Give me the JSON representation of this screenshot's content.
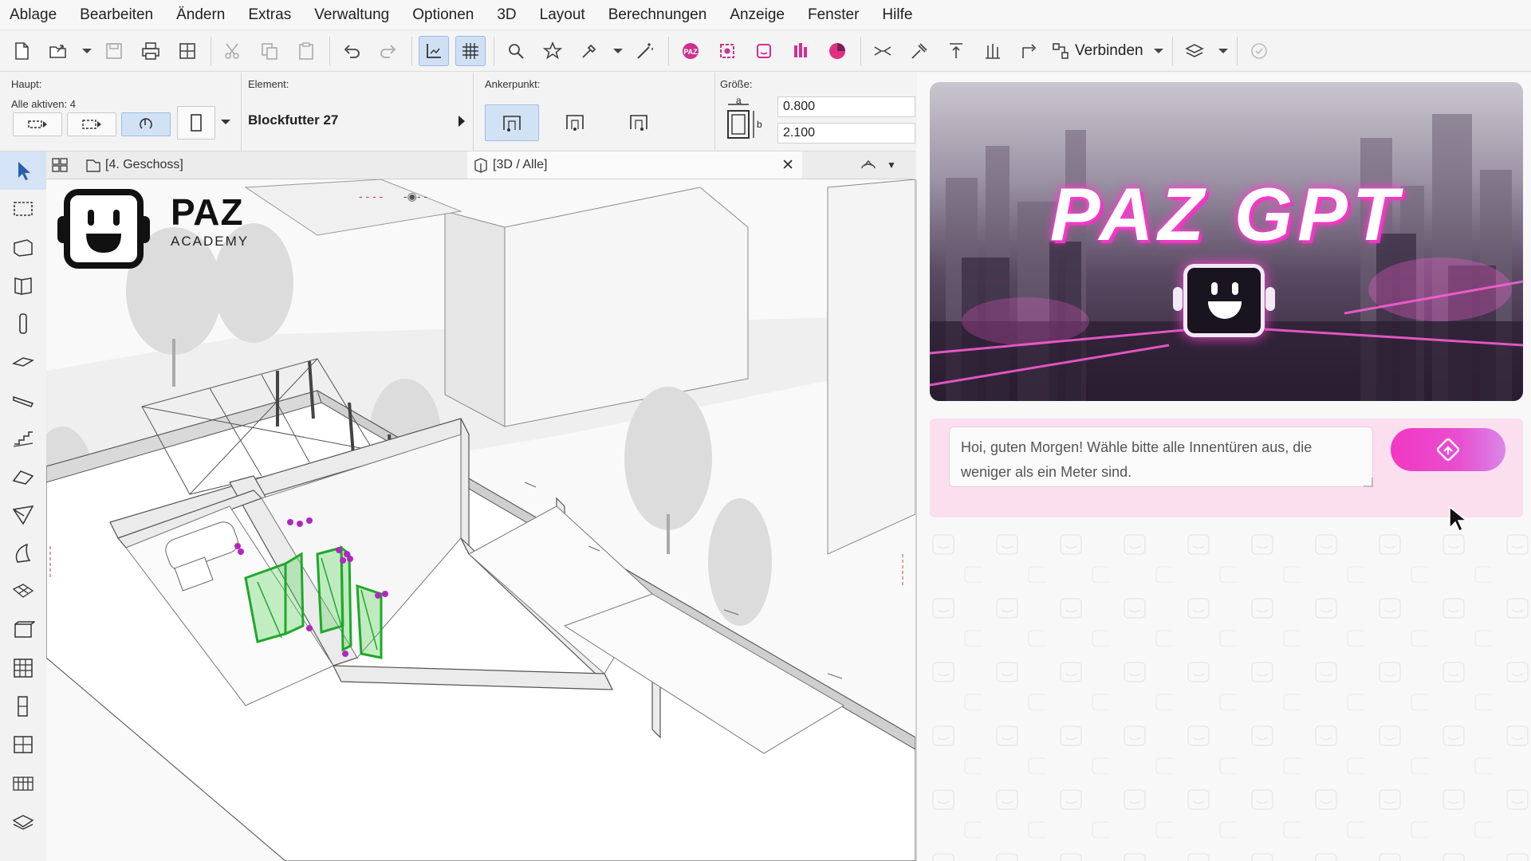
{
  "menu": {
    "items": [
      "Ablage",
      "Bearbeiten",
      "Ändern",
      "Extras",
      "Verwaltung",
      "Optionen",
      "3D",
      "Layout",
      "Berechnungen",
      "Anzeige",
      "Fenster",
      "Hilfe"
    ]
  },
  "toolbar": {
    "verbinden_label": "Verbinden",
    "icons": [
      "new-file",
      "open",
      "save",
      "print",
      "publish",
      "cut",
      "copy",
      "paste",
      "undo",
      "redo",
      "trace",
      "grid",
      "find",
      "favorites",
      "eyedropper",
      "magic-wand",
      "paz-gpt",
      "rendering",
      "model-check",
      "section",
      "pie",
      "split",
      "adjust",
      "elevate",
      "distribute",
      "offset",
      "connect",
      "layers",
      "teamwork"
    ]
  },
  "infobox": {
    "haupt_label": "Haupt:",
    "alle_aktiven": "Alle aktiven: 4",
    "element_label": "Element:",
    "element_value": "Blockfutter 27",
    "ankerpunkt_label": "Ankerpunkt:",
    "groesse_label": "Größe:",
    "width_value": "0.800",
    "height_value": "2.100",
    "dim_a": "a",
    "dim_b": "b"
  },
  "tabs": {
    "floor_plan": "[4. Geschoss]",
    "view_3d": "[3D / Alle]"
  },
  "logo": {
    "name": "PAZ",
    "subtitle": "ACADEMY"
  },
  "panel": {
    "banner_title": "PAZ GPT",
    "chat_message": "Hoi, guten Morgen! Wähle bitte alle Innentüren aus, die weniger als ein Meter sind.",
    "accent_color": "#f237c2"
  }
}
